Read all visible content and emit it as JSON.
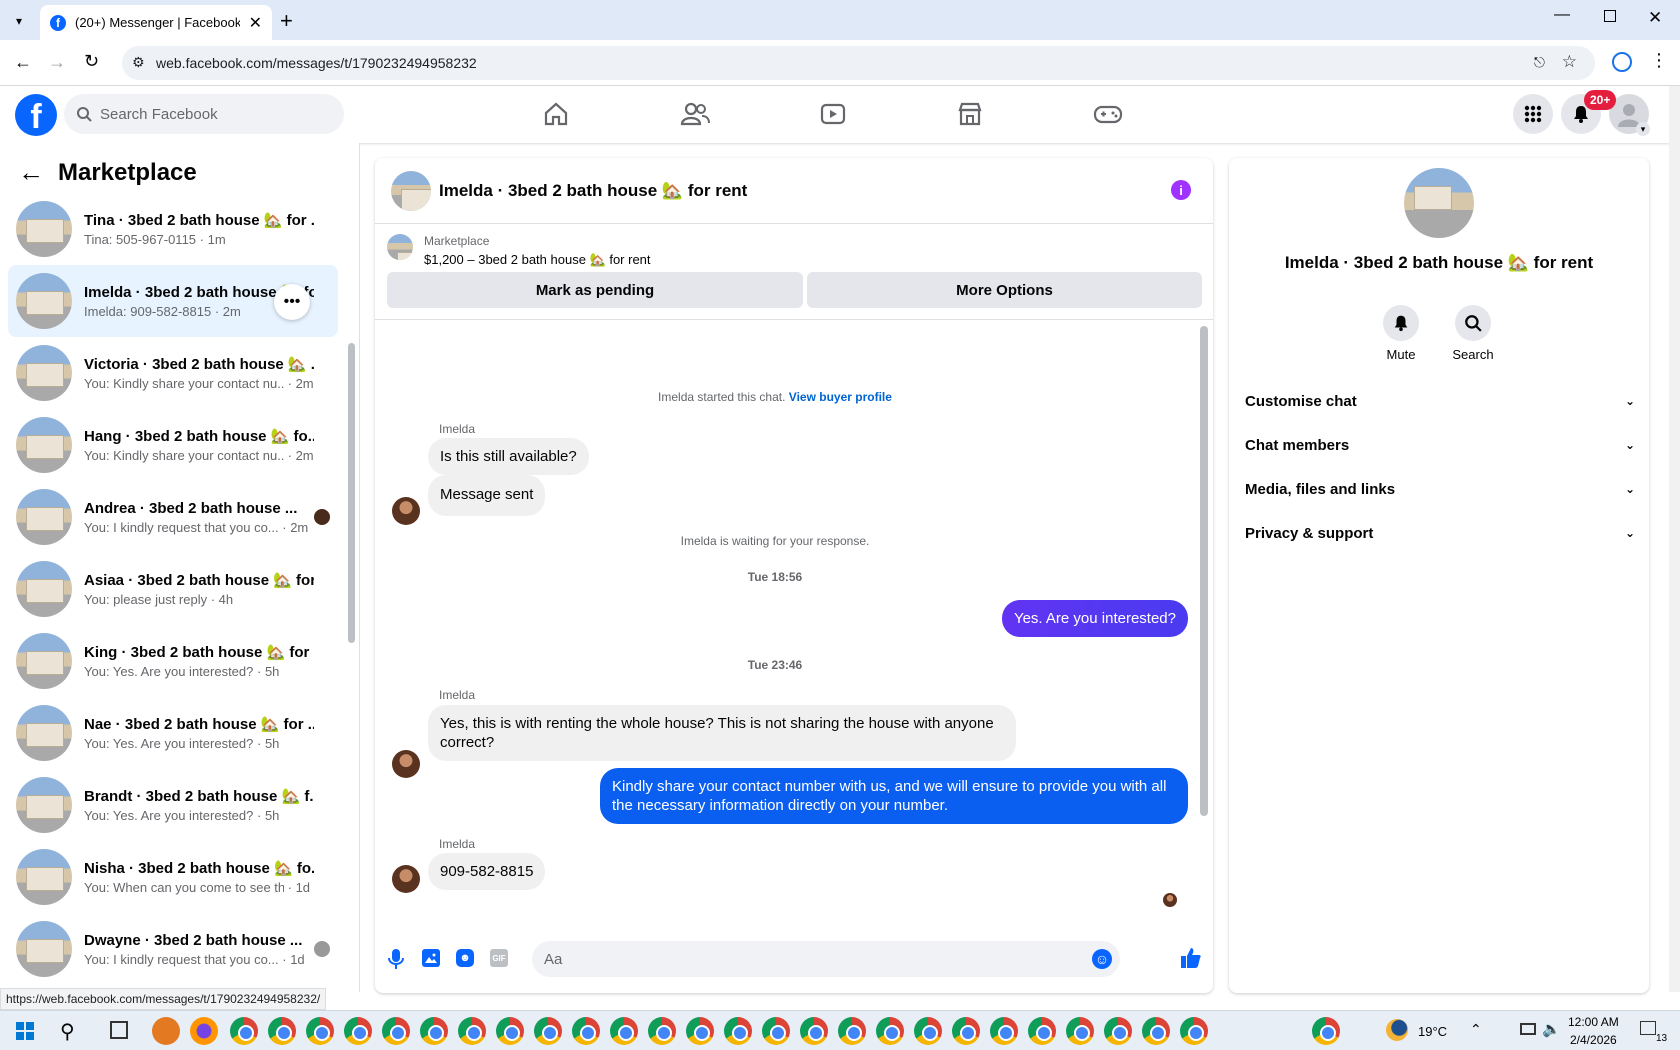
{
  "browser": {
    "tab_title": "(20+) Messenger | Facebook",
    "url": "web.facebook.com/messages/t/1790232494958232",
    "status_url": "https://web.facebook.com/messages/t/1790232494958232/"
  },
  "fb": {
    "search_placeholder": "Search Facebook",
    "notif_badge": "20+",
    "brand_color": "#0866ff"
  },
  "sidebar": {
    "title": "Marketplace",
    "conversations": [
      {
        "name": "Tina · 3bed 2 bath house 🏡 for ...",
        "preview": "Tina: 505-967-0115",
        "time": "1m"
      },
      {
        "name": "Imelda · 3bed 2 bath house 🏡 fo...",
        "preview": "Imelda: 909-582-8815",
        "time": "2m"
      },
      {
        "name": "Victoria · 3bed 2 bath house 🏡 ...",
        "preview": "You: Kindly share your contact nu...",
        "time": "2m"
      },
      {
        "name": "Hang · 3bed 2 bath house 🏡 fo...",
        "preview": "You: Kindly share your contact nu...",
        "time": "2m"
      },
      {
        "name": "Andrea · 3bed 2 bath house ...",
        "preview": "You: I kindly request that you co...",
        "time": "2m"
      },
      {
        "name": "Asiaa · 3bed 2 bath house 🏡 for...",
        "preview": "You: please just reply",
        "time": "4h"
      },
      {
        "name": "King · 3bed 2 bath house 🏡 for ...",
        "preview": "You: Yes. Are you interested?",
        "time": "5h"
      },
      {
        "name": "Nae · 3bed 2 bath house 🏡 for ...",
        "preview": "You: Yes. Are you interested?",
        "time": "5h"
      },
      {
        "name": "Brandt · 3bed 2 bath house 🏡 f...",
        "preview": "You: Yes. Are you interested?",
        "time": "5h"
      },
      {
        "name": "Nisha · 3bed 2 bath house 🏡 fo...",
        "preview": "You: When can you come to see th...",
        "time": "1d"
      },
      {
        "name": "Dwayne · 3bed 2 bath house ...",
        "preview": "You: I kindly request that you co...",
        "time": "1d"
      }
    ]
  },
  "chat": {
    "title": "Imelda · 3bed 2 bath house 🏡 for rent",
    "listing_label": "Marketplace",
    "listing_price": "$1,200 – 3bed 2 bath house 🏡 for rent",
    "mark_pending": "Mark as pending",
    "more_options": "More Options",
    "started_text": "Imelda started this chat.",
    "view_profile": "View buyer profile",
    "sender_name": "Imelda",
    "msg1": "Is this still available?",
    "msg2": "Message sent",
    "waiting": "Imelda is waiting for your response.",
    "time1": "Tue 18:56",
    "out1": "Yes. Are you interested?",
    "time2": "Tue 23:46",
    "msg3": "Yes, this is with renting the whole house? This is not sharing the house with anyone correct?",
    "out2": "Kindly share your contact number with us, and we will ensure to provide you with all the necessary information directly on your number.",
    "msg4": "909-582-8815",
    "composer_placeholder": "Aa"
  },
  "details": {
    "name": "Imelda · 3bed 2 bath house 🏡 for rent",
    "mute": "Mute",
    "search": "Search",
    "sections": [
      "Customise chat",
      "Chat members",
      "Media, files and links",
      "Privacy & support"
    ]
  },
  "taskbar": {
    "temp": "19°C",
    "time": "12:00 AM",
    "date": "2/4/2026",
    "notif_count": "13"
  }
}
